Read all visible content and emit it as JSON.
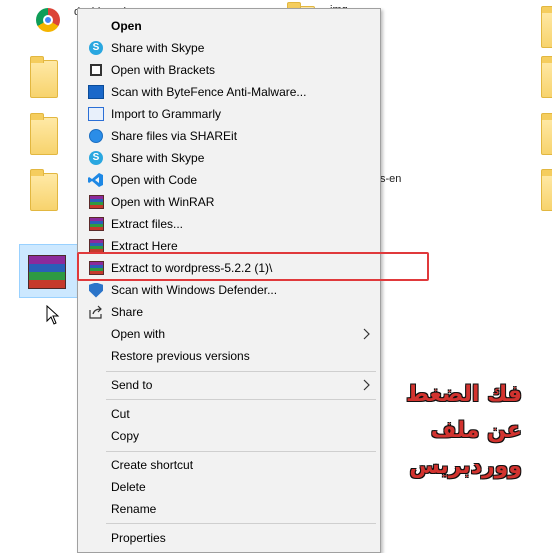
{
  "background": {
    "items": [
      {
        "label": "dashboard"
      },
      {
        "label": "img"
      },
      {
        "label": "s-en"
      }
    ]
  },
  "menu": {
    "items": [
      {
        "label": "Open",
        "icon": "none",
        "bold": true
      },
      {
        "label": "Share with Skype",
        "icon": "skype-icon"
      },
      {
        "label": "Open with Brackets",
        "icon": "brackets-icon"
      },
      {
        "label": "Scan with ByteFence Anti-Malware...",
        "icon": "bytefence-icon"
      },
      {
        "label": "Import to Grammarly",
        "icon": "grammarly-icon"
      },
      {
        "label": "Share files via SHAREit",
        "icon": "shareit-icon"
      },
      {
        "label": "Share with Skype",
        "icon": "skype-icon"
      },
      {
        "label": "Open with Code",
        "icon": "vscode-icon"
      },
      {
        "label": "Open with WinRAR",
        "icon": "winrar-icon"
      },
      {
        "label": "Extract files...",
        "icon": "winrar-icon"
      },
      {
        "label": "Extract Here",
        "icon": "winrar-icon"
      },
      {
        "label": "Extract to wordpress-5.2.2 (1)\\",
        "icon": "winrar-icon"
      },
      {
        "label": "Scan with Windows Defender...",
        "icon": "defender-icon"
      },
      {
        "label": "Share",
        "icon": "share-icon"
      },
      {
        "label": "Open with",
        "icon": "none",
        "submenu": true
      },
      {
        "label": "Restore previous versions",
        "icon": "none"
      },
      {
        "label": "Send to",
        "icon": "none",
        "submenu": true
      },
      {
        "label": "Cut",
        "icon": "none"
      },
      {
        "label": "Copy",
        "icon": "none"
      },
      {
        "label": "Create shortcut",
        "icon": "none"
      },
      {
        "label": "Delete",
        "icon": "none"
      },
      {
        "label": "Rename",
        "icon": "none"
      },
      {
        "label": "Properties",
        "icon": "none"
      }
    ]
  },
  "annotation": {
    "lines": [
      "فك الضغط",
      "عن ملف",
      "ووردبريس"
    ],
    "color": "#d2332f"
  },
  "colors": {
    "highlight": "#e0393b",
    "menu_bg": "#f2f2f2",
    "selection": "#cce8ff"
  }
}
